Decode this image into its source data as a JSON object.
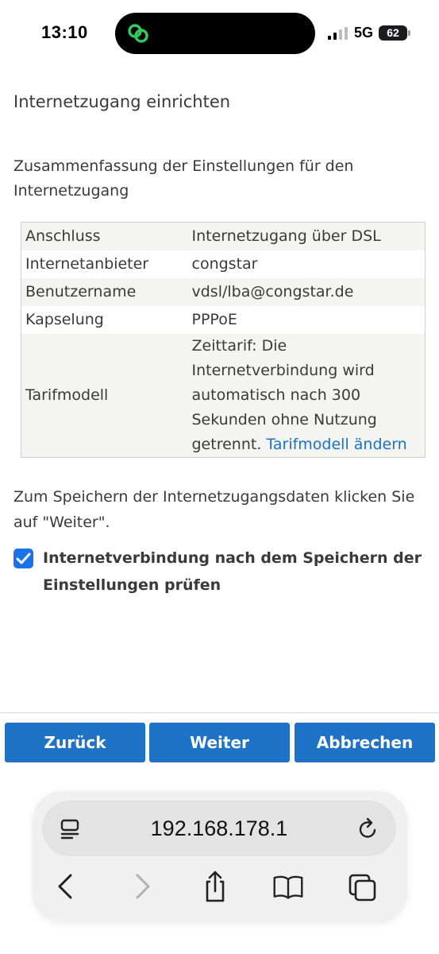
{
  "status_bar": {
    "time": "13:10",
    "network": "5G",
    "battery": "62"
  },
  "page": {
    "title": "Internetzugang einrichten",
    "summary_heading": "Zusammenfassung der Einstellungen für den Internetzugang",
    "table": {
      "rows": [
        {
          "label": "Anschluss",
          "value": "Internetzugang über DSL"
        },
        {
          "label": "Internetanbieter",
          "value": "congstar"
        },
        {
          "label": "Benutzername",
          "value": "vdsl/lba@congstar.de"
        },
        {
          "label": "Kapselung",
          "value": "PPPoE"
        },
        {
          "label": "Tarifmodell",
          "value": "Zeittarif: Die Internetverbindung wird automatisch nach 300 Sekunden ohne Nutzung getrennt.",
          "link": "Tarifmodell ändern"
        }
      ]
    },
    "save_instruction": "Zum Speichern der Internetzugangsdaten klicken Sie auf \"Weiter\".",
    "checkbox": {
      "checked": true,
      "label": "Internetverbindung nach dem Speichern der Einstellungen prüfen"
    }
  },
  "buttons": {
    "back": "Zurück",
    "next": "Weiter",
    "cancel": "Abbrechen"
  },
  "browser": {
    "url": "192.168.178.1",
    "icons": [
      "tabs-menu-icon",
      "reload-icon",
      "back-arrow-icon",
      "forward-arrow-icon",
      "share-icon",
      "bookmarks-icon",
      "tab-switcher-icon"
    ]
  },
  "colors": {
    "accent": "#1f73c6",
    "link": "#1a73c4",
    "checkbox": "#1a73e8"
  }
}
